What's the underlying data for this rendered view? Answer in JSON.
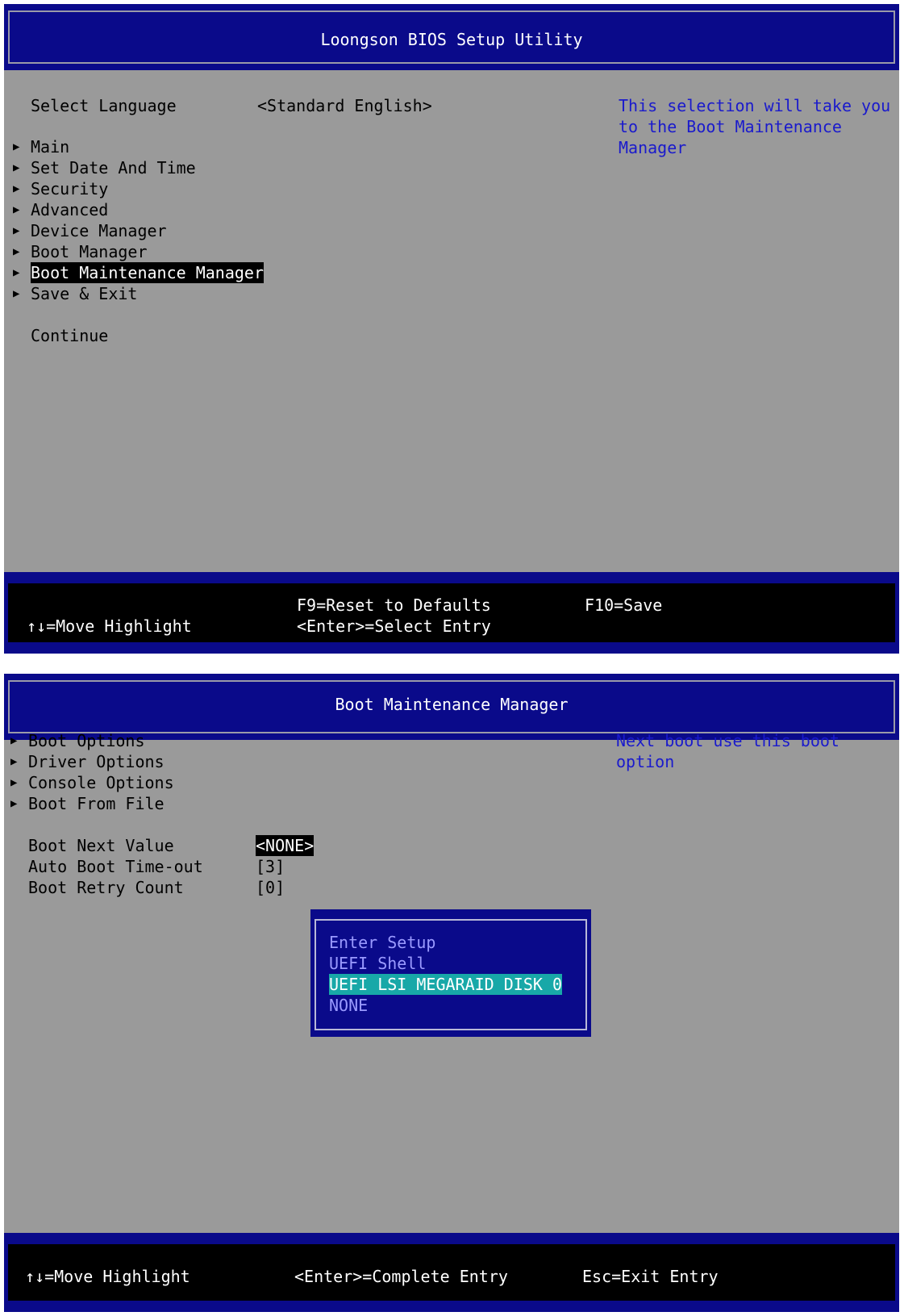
{
  "screen1": {
    "title": "Loongson BIOS Setup Utility",
    "language_label": "Select Language",
    "language_value": "<Standard English>",
    "menu_items": [
      "Main",
      "Set Date And Time",
      "Security",
      "Advanced",
      "Device Manager",
      "Boot Manager",
      "Boot Maintenance Manager",
      "Save & Exit"
    ],
    "selected_item": "Boot Maintenance Manager",
    "continue_label": "Continue",
    "help_text": "This selection will take you to the Boot Maintenance Manager",
    "footer": {
      "move": "↑↓=Move Highlight",
      "reset": "F9=Reset to Defaults",
      "select": "<Enter>=Select Entry",
      "save": "F10=Save"
    }
  },
  "screen2": {
    "title": "Boot Maintenance Manager",
    "menu_items": [
      "Boot Options",
      "Driver Options",
      "Console Options",
      "Boot From File"
    ],
    "settings": [
      {
        "label": "Boot Next Value",
        "value": "<NONE>"
      },
      {
        "label": "Auto Boot Time-out",
        "value": "[3]"
      },
      {
        "label": "Boot Retry Count",
        "value": "[0]"
      }
    ],
    "help_text": "Next boot use this boot option",
    "popup_options": [
      "Enter Setup",
      "UEFI Shell",
      "UEFI LSI MEGARAID DISK 0",
      "NONE"
    ],
    "popup_selected": "UEFI LSI MEGARAID DISK 0",
    "footer": {
      "move": "↑↓=Move Highlight",
      "complete": "<Enter>=Complete Entry",
      "exit": "Esc=Exit Entry"
    }
  },
  "colors": {
    "screen_bg": "#9a9a9a",
    "bar_blue": "#0a0a8a",
    "help_blue": "#1a1acc",
    "popup_highlight": "#18a8a8"
  }
}
